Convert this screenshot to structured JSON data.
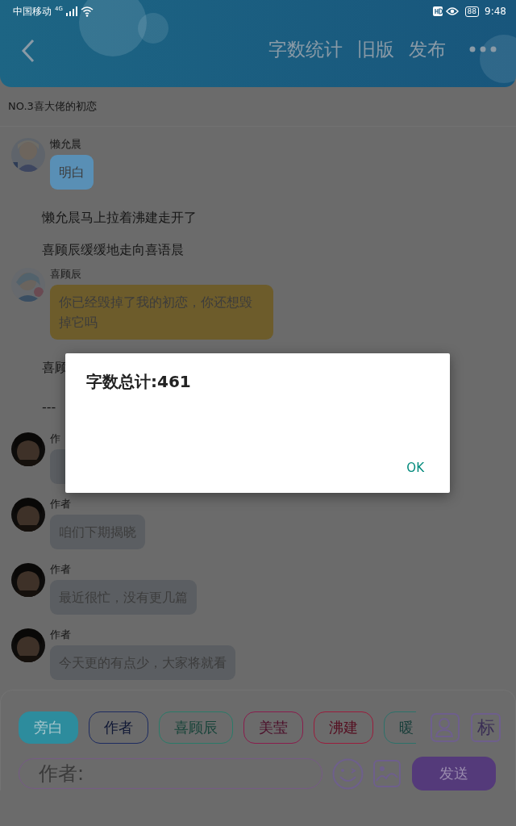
{
  "status_bar": {
    "carrier": "中国移动",
    "network": "4G",
    "battery": "88",
    "time": "9:48"
  },
  "header": {
    "actions": [
      "字数统计",
      "旧版",
      "发布"
    ]
  },
  "chapter_title": "NO.3喜大佬的初恋",
  "messages": [
    {
      "kind": "message",
      "name": "懒允晨",
      "text": "明白",
      "color": "#598fb5"
    },
    {
      "kind": "narration",
      "text": "懒允晨马上拉着沸建走开了"
    },
    {
      "kind": "narration",
      "text": "喜顾辰缓缓地走向喜语晨"
    },
    {
      "kind": "message",
      "name": "喜顾辰",
      "text": "你已经毁掉了我的初恋，你还想毁掉它吗",
      "color": "#6d5c2b"
    },
    {
      "kind": "narration",
      "text": "喜顾"
    },
    {
      "kind": "divider",
      "text": "---"
    },
    {
      "kind": "message",
      "name": "作",
      "color": "#5b5e62"
    },
    {
      "kind": "message",
      "name": "作者",
      "text": "咱们下期揭晓",
      "color": "#5b5e62"
    },
    {
      "kind": "message",
      "name": "作者",
      "text": "最近很忙，没有更几篇",
      "color": "#5b5e62"
    },
    {
      "kind": "message",
      "name": "作者",
      "text": "今天更的有点少，大家将就看",
      "color": "#5b5e62"
    }
  ],
  "roles": [
    {
      "label": "旁白",
      "color": "#2d8c9d",
      "selected": true
    },
    {
      "label": "作者",
      "color": "#1d2b60",
      "selected": false
    },
    {
      "label": "喜顾辰",
      "color": "#2a7a68",
      "selected": false
    },
    {
      "label": "美莹",
      "color": "#8a1c4c",
      "selected": false
    },
    {
      "label": "沸建",
      "color": "#9a1c3c",
      "selected": false
    },
    {
      "label": "暖",
      "color": "#2c716a",
      "selected": false
    }
  ],
  "tag_button": "标",
  "composer": {
    "placeholder": "作者:",
    "send": "发送"
  },
  "dialog": {
    "message": "字数总计:461",
    "ok": "OK"
  }
}
